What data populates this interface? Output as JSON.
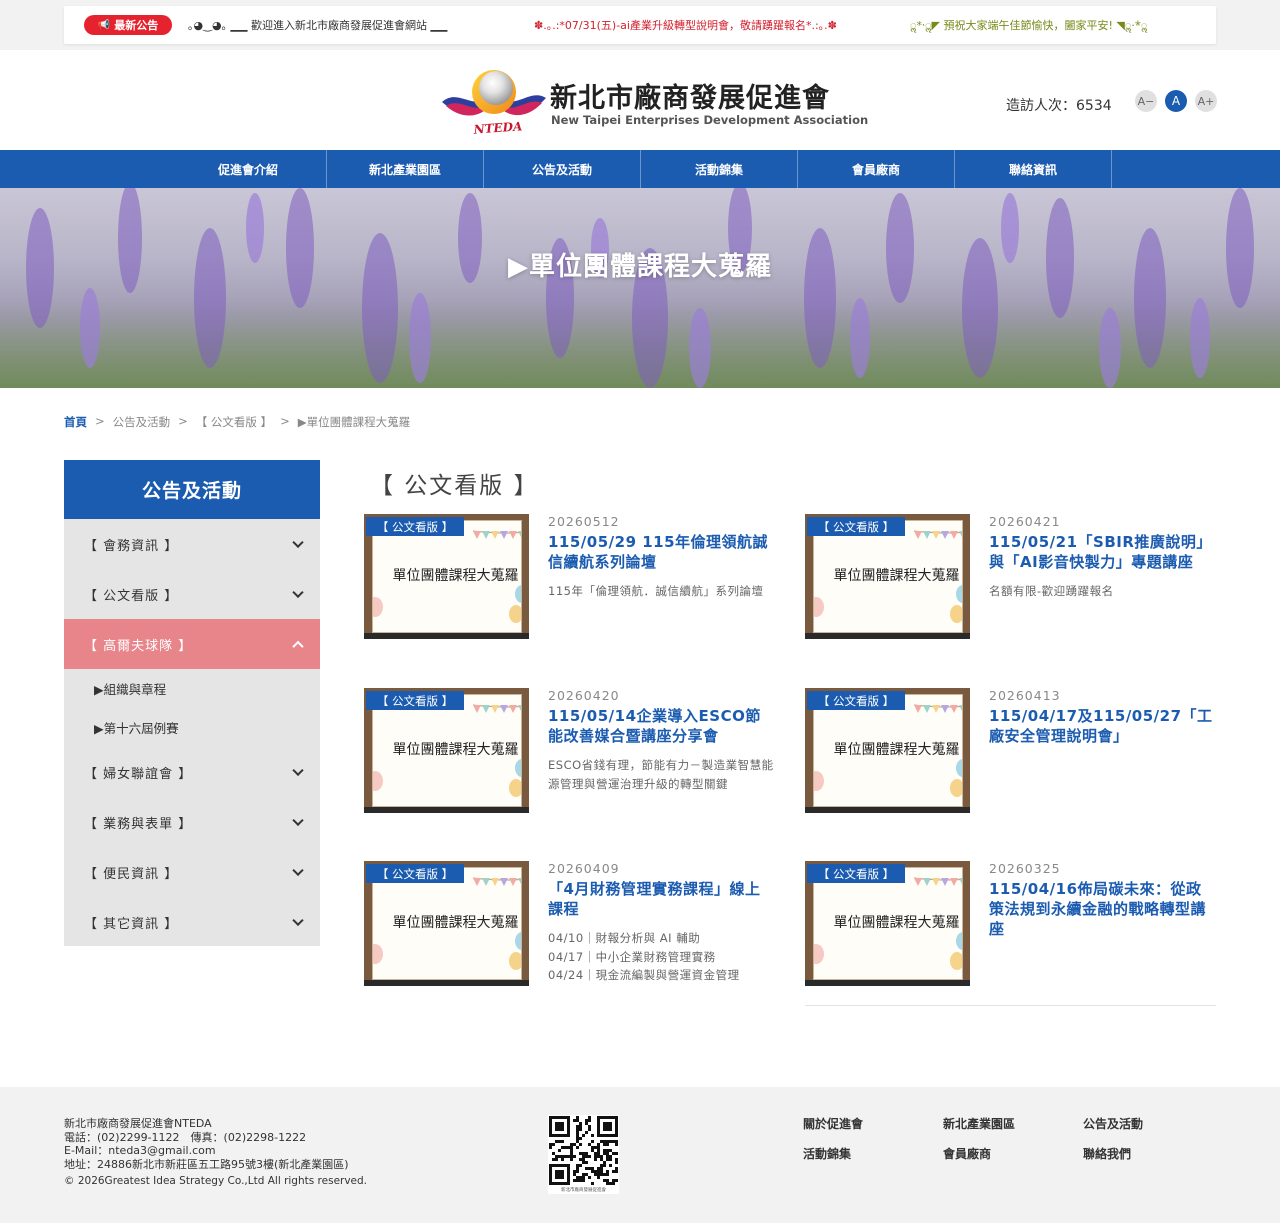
{
  "topbar": {
    "badge_icon": "megaphone-icon",
    "badge_label": "最新公告",
    "ticker1": "｡◕‿◕｡ ▁▁ 歡迎進入新北市廠商發展促進會網站 ▁▁",
    "ticker2": "✽.｡.:*07/31(五)-ai產業升級轉型說明會，敬請踴躍報名*.:｡.✽",
    "ticker3": "ॢ*·ॢ◤ 預祝大家端午佳節愉快，闔家平安! ◥ॢ·*ॢ"
  },
  "header": {
    "logo_word": "NTEDA",
    "title": "新北市廠商發展促進會",
    "subtitle": "New Taipei Enterprises Development Association",
    "visitor": "造訪人次：6534",
    "font_small": "A−",
    "font_mid": "A",
    "font_large": "A+"
  },
  "nav": [
    "促進會介紹",
    "新北產業園區",
    "公告及活動",
    "活動錦集",
    "會員廠商",
    "聯絡資訊"
  ],
  "banner": {
    "title": "▶單位團體課程大蒐羅"
  },
  "breadcrumb": {
    "home": "首頁",
    "sep": ">",
    "c1": "公告及活動",
    "c2": "【 公文看版 】",
    "c3": "▶單位團體課程大蒐羅"
  },
  "sidebar": {
    "heading": "公告及活動",
    "items": [
      {
        "label": "【 會務資訊 】"
      },
      {
        "label": "【 公文看版 】"
      },
      {
        "label": "【 高爾夫球隊 】"
      },
      {
        "label": "【 婦女聯誼會 】"
      },
      {
        "label": "【 業務與表單 】"
      },
      {
        "label": "【 便民資訊 】"
      },
      {
        "label": "【 其它資訊 】"
      }
    ],
    "sub_items": [
      "▶組織與章程",
      "▶第十六屆例賽"
    ]
  },
  "content": {
    "title": "【 公文看版 】",
    "thumb_tag": "【 公文看版 】",
    "thumb_text": "單位團體課程大蒐羅",
    "cards": [
      {
        "date": "20260512",
        "title": "115/05/29 115年倫理領航誠信續航系列論壇",
        "desc": "115年「倫理領航．誠信續航」系列論壇"
      },
      {
        "date": "20260421",
        "title": "115/05/21「SBIR推廣說明」與「AI影音快製力」專題講座",
        "desc": "名額有限-歡迎踴躍報名"
      },
      {
        "date": "20260420",
        "title": "115/05/14企業導入ESCO節能改善媒合暨講座分享會",
        "desc": "ESCO省錢有理，節能有力－製造業智慧能源管理與營運治理升級的轉型關鍵"
      },
      {
        "date": "20260413",
        "title": "115/04/17及115/05/27「工廠安全管理說明會」",
        "desc": ""
      },
      {
        "date": "20260409",
        "title": "「4月財務管理實務課程」線上課程",
        "desc": "04/10｜財報分析與 AI 輔助\n04/17｜中小企業財務管理實務\n04/24｜現金流編製與營運資金管理"
      },
      {
        "date": "20260325",
        "title": "115/04/16佈局碳未來：從政策法規到永續金融的戰略轉型講座",
        "desc": ""
      }
    ]
  },
  "footer": {
    "name": "新北市廠商發展促進會NTEDA",
    "phone": "電話：(02)2299-1122　傳真：(02)2298-1222",
    "email": "E-Mail：nteda3@gmail.com",
    "address": "地址：24886新北市新莊區五工路95號3樓(新北產業園區)",
    "copyright": "© 2026Greatest Idea Strategy Co.,Ltd All rights reserved.",
    "qr_caption": "新北市廠商發展促進會",
    "links": [
      "關於促進會",
      "新北產業園區",
      "公告及活動",
      "活動錦集",
      "會員廠商",
      "聯絡我們"
    ]
  },
  "colors": {
    "primary": "#1c5cb0",
    "accent_red": "#e5232f",
    "active_pink": "#e8858a",
    "footer_bg": "#f2f2f2"
  }
}
